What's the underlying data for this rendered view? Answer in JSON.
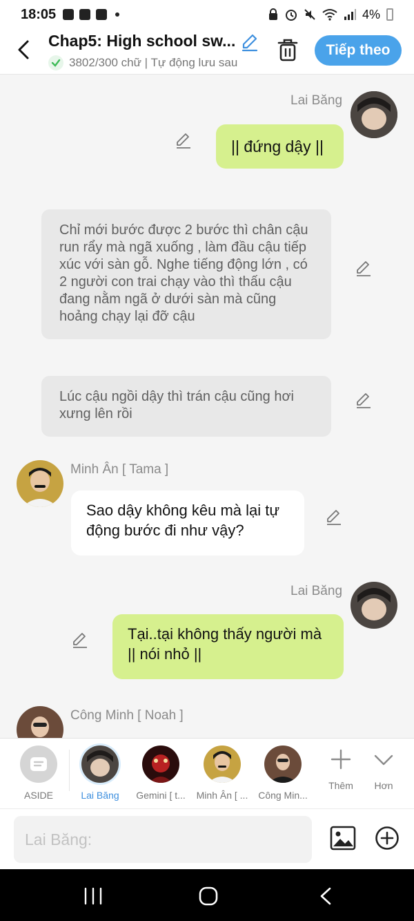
{
  "status_bar": {
    "time": "18:05",
    "battery": "4%"
  },
  "header": {
    "title": "Chap5: High school sw...",
    "subtitle": "3802/300 chữ | Tự động lưu sau",
    "next_label": "Tiếp theo"
  },
  "messages": [
    {
      "speaker": "Lai Băng",
      "text": "|| đứng dậy ||"
    },
    {
      "narration": "Chỉ mới bước được 2 bước thì chân cậu run rẩy mà ngã xuống , làm đầu cậu tiếp xúc với sàn gỗ. Nghe tiếng động lớn , có 2 người con trai chạy vào thì thấu cậu đang nằm ngã ở dưới sàn mà cũng hoảng chạy lại đỡ cậu"
    },
    {
      "narration": "Lúc cậu ngồi dậy thì trán cậu cũng hơi xưng lên rồi"
    },
    {
      "speaker": "Minh Ân [ Tama ]",
      "text": "Sao dậy không kêu mà lại tự động bước đi như vậy?"
    },
    {
      "speaker": "Lai Băng",
      "text": "Tại..tại không thấy người mà || nói nhỏ ||"
    },
    {
      "speaker": "Công Minh [ Noah ]"
    }
  ],
  "characters": [
    {
      "label": "ASIDE"
    },
    {
      "label": "Lai Băng"
    },
    {
      "label": "Gemini [ t..."
    },
    {
      "label": "Minh Ân [ ..."
    },
    {
      "label": "Công Min..."
    }
  ],
  "actions": {
    "more_label": "Thêm",
    "expand_label": "Hơn"
  },
  "input": {
    "placeholder": "Lai Băng:"
  },
  "colors": {
    "accent": "#4aa3ea",
    "my_bubble": "#d6f08e",
    "narration_bg": "#e8e8e8"
  }
}
